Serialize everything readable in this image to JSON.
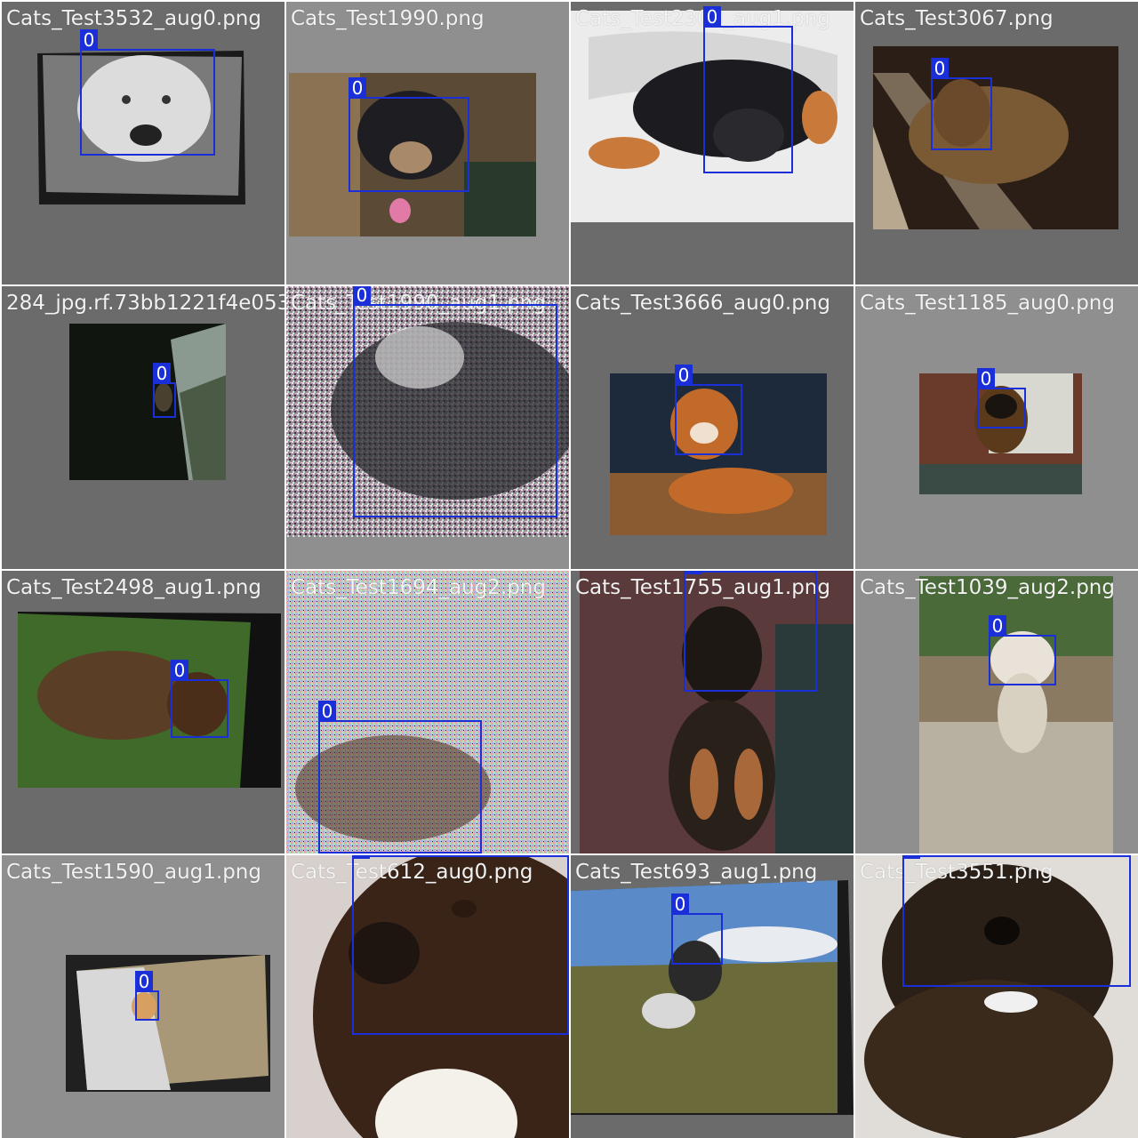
{
  "mosaic": {
    "class_label": "0",
    "box_color": "#1a2fd8",
    "tiles": [
      {
        "file": "Cats_Test3532_aug0.png",
        "bg": "#6b6b6b",
        "subject": "white samoyed dog face, grayscale",
        "photo": {
          "c1": "#d9d9d9",
          "c2": "#4a4a4a"
        }
      },
      {
        "file": "Cats_Test1990.png",
        "bg": "#8f8f8f",
        "subject": "black and tan chihuahua on couch",
        "photo": {
          "c1": "#3a3a2e",
          "c2": "#8c7a5c"
        }
      },
      {
        "file": "Cats_Test2309_aug1.png",
        "bg": "#6b6b6b",
        "subject": "miniature pinscher lying on white chair",
        "photo": {
          "c1": "#eeeeee",
          "c2": "#c9c9c9"
        }
      },
      {
        "file": "Cats_Test3067.png",
        "bg": "#6b6b6b",
        "subject": "yorkshire terrier on carpet",
        "photo": {
          "c1": "#3a2a1a",
          "c2": "#8a6a4a"
        }
      },
      {
        "file": "284_jpg.rf.73bb1221f4e05356d7e2f8e2e86",
        "bg": "#6b6b6b",
        "subject": "dark night scene with small animal",
        "photo": {
          "c1": "#0f1410",
          "c2": "#4a5548"
        }
      },
      {
        "file": "Cats_Test1990_aug1.png",
        "bg": "#8f8f8f",
        "subject": "noisy black and white dog close-up",
        "photo": {
          "c1": "#222222",
          "c2": "#f0f0f0"
        }
      },
      {
        "file": "Cats_Test3666_aug0.png",
        "bg": "#6b6b6b",
        "subject": "shiba inu lying on wooden floor",
        "photo": {
          "c1": "#1c2a3c",
          "c2": "#8a5a30"
        }
      },
      {
        "file": "Cats_Test1185_aug0.png",
        "bg": "#8f8f8f",
        "subject": "leonberger puppy at a gate",
        "photo": {
          "c1": "#6a3a2a",
          "c2": "#4a5a50"
        }
      },
      {
        "file": "Cats_Test2498_aug1.png",
        "bg": "#6b6b6b",
        "subject": "fluffy brown dog on grass",
        "photo": {
          "c1": "#3f6a2a",
          "c2": "#6a4a2a"
        }
      },
      {
        "file": "Cats_Test1694_aug2.png",
        "bg": "#8f8f8f",
        "subject": "very noisy image of a dog",
        "photo": {
          "c1": "#c8c0c8",
          "c2": "#5a3a2a"
        }
      },
      {
        "file": "Cats_Test1755_aug1.png",
        "bg": "#6b6b6b",
        "subject": "black and tan miniature pinscher sitting",
        "photo": {
          "c1": "#5a3a3a",
          "c2": "#2a3a3a"
        }
      },
      {
        "file": "Cats_Test1039_aug2.png",
        "bg": "#8f8f8f",
        "subject": "small white dog standing in a puddle",
        "photo": {
          "c1": "#4a6a3a",
          "c2": "#b8b0a0"
        }
      },
      {
        "file": "Cats_Test1590_aug1.png",
        "bg": "#8f8f8f",
        "subject": "pomeranian on a beach",
        "photo": {
          "c1": "#d8d8d8",
          "c2": "#a89878"
        }
      },
      {
        "file": "Cats_Test612_aug0.png",
        "bg": "#6b6b6b",
        "subject": "brindle staffordshire terrier close-up",
        "photo": {
          "c1": "#d8d0cc",
          "c2": "#2a1a14"
        }
      },
      {
        "file": "Cats_Test693_aug1.png",
        "bg": "#6b6b6b",
        "subject": "pointer dog in a field under cloudy sky",
        "photo": {
          "c1": "#5a8ac8",
          "c2": "#6a6a3a"
        }
      },
      {
        "file": "Cats_Test3551.png",
        "bg": "#8f8f8f",
        "subject": "yorkshire terrier puppy close-up",
        "photo": {
          "c1": "#e0dcd8",
          "c2": "#3a2a1a"
        }
      }
    ]
  }
}
